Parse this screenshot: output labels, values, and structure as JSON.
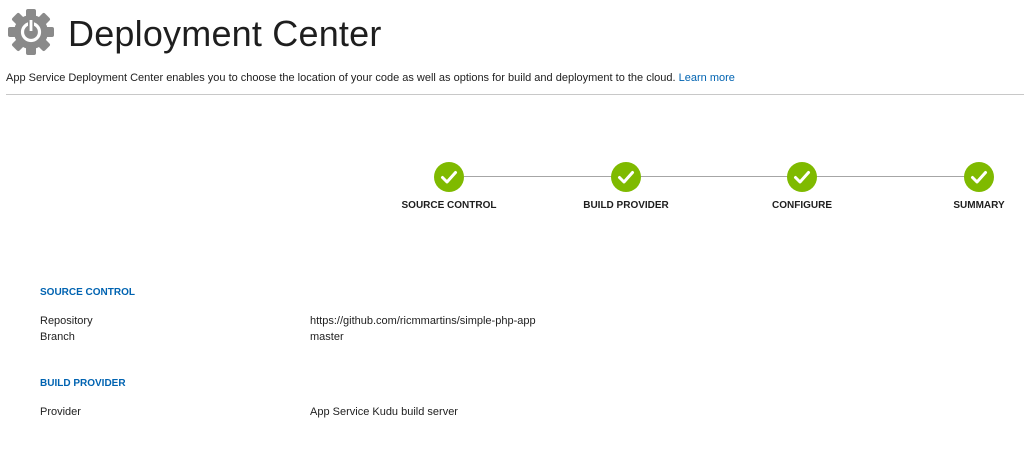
{
  "header": {
    "title": "Deployment Center",
    "icon": "gear-icon",
    "description": "App Service Deployment Center enables you to choose the location of your code as well as options for build and deployment to the cloud.",
    "learn_more": "Learn more"
  },
  "steps": [
    {
      "label": "SOURCE CONTROL",
      "status": "complete"
    },
    {
      "label": "BUILD PROVIDER",
      "status": "complete"
    },
    {
      "label": "CONFIGURE",
      "status": "complete"
    },
    {
      "label": "SUMMARY",
      "status": "complete"
    }
  ],
  "summary": {
    "source_control": {
      "heading": "SOURCE CONTROL",
      "repository_label": "Repository",
      "repository_value": "https://github.com/ricmmartins/simple-php-app",
      "branch_label": "Branch",
      "branch_value": "master"
    },
    "build_provider": {
      "heading": "BUILD PROVIDER",
      "provider_label": "Provider",
      "provider_value": "App Service Kudu build server"
    }
  },
  "colors": {
    "accent": "#0063b1",
    "step_complete": "#7fba00",
    "gear": "#8a8a8a"
  }
}
